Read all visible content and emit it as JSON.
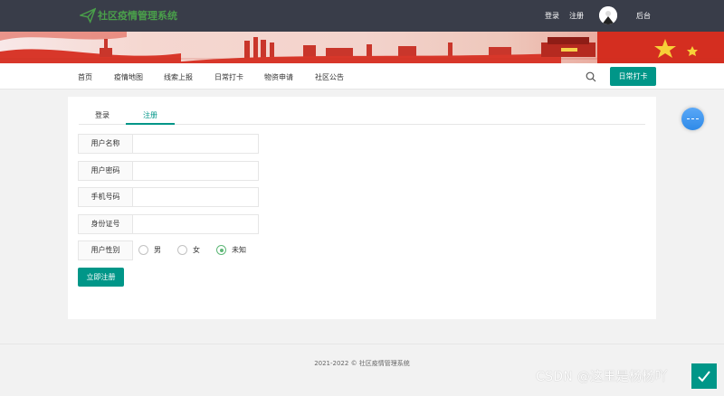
{
  "app": {
    "title": "社区疫情管理系统",
    "brand_color": "#4a9f4a",
    "header_color": "#393d49",
    "accent": "#009688"
  },
  "header": {
    "login": "登录",
    "register": "注册",
    "avatar_text": "",
    "admin": "后台"
  },
  "nav": {
    "items": [
      "首页",
      "疫情地图",
      "线索上报",
      "日常打卡",
      "物资申请",
      "社区公告"
    ],
    "checkin_button": "日常打卡"
  },
  "tabs": {
    "login": "登录",
    "register": "注册",
    "active": "register"
  },
  "form": {
    "fields": [
      {
        "label": "用户名称",
        "value": "",
        "placeholder": ""
      },
      {
        "label": "用户密码",
        "value": "",
        "placeholder": ""
      },
      {
        "label": "手机号码",
        "value": "",
        "placeholder": ""
      },
      {
        "label": "身份证号",
        "value": "",
        "placeholder": ""
      }
    ],
    "gender_label": "用户性别",
    "gender_options": [
      "男",
      "女",
      "未知"
    ],
    "gender_selected": "未知",
    "submit_label": "立即注册"
  },
  "footer": {
    "copyright": "2021-2022 © 社区疫情管理系统"
  },
  "watermark": "CSDN @这里是杨杨吖"
}
